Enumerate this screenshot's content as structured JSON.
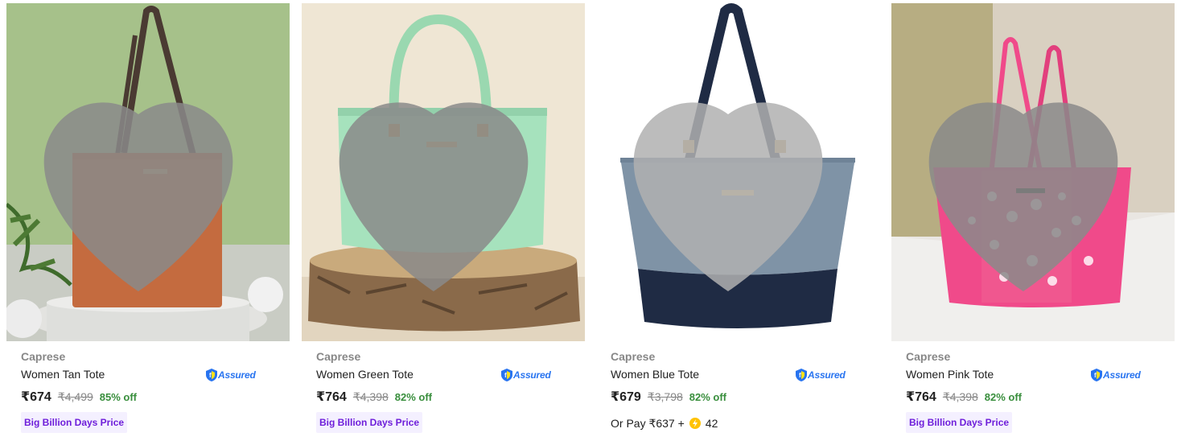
{
  "products": [
    {
      "brand": "Caprese",
      "title": "Women Tan Tote",
      "assured_label": "Assured",
      "price": "₹674",
      "mrp": "₹4,499",
      "discount": "85% off",
      "offer_badge": "Big Billion Days Price",
      "bag_color": "#c56a3d",
      "bg_color": "#a8c08c"
    },
    {
      "brand": "Caprese",
      "title": "Women Green Tote",
      "assured_label": "Assured",
      "price": "₹764",
      "mrp": "₹4,398",
      "discount": "82% off",
      "offer_badge": "Big Billion Days Price",
      "bag_color": "#9fe0b8",
      "bg_color": "#efe5d2"
    },
    {
      "brand": "Caprese",
      "title": "Women Blue Tote",
      "assured_label": "Assured",
      "price": "₹679",
      "mrp": "₹3,798",
      "discount": "82% off",
      "supercoin_prefix": "Or Pay ₹637 +",
      "supercoin_value": "42",
      "bag_color": "#7f93a6",
      "bg_color": "#ffffff"
    },
    {
      "brand": "Caprese",
      "title": "Women Pink Tote",
      "assured_label": "Assured",
      "price": "₹764",
      "mrp": "₹4,398",
      "discount": "82% off",
      "offer_badge": "Big Billion Days Price",
      "bag_color": "#f04a8a",
      "bg_color": "#d9d3c4"
    }
  ],
  "icons": {
    "wishlist": "heart-icon",
    "assured": "flipkart-assured-shield-icon",
    "supercoin": "supercoin-icon"
  }
}
